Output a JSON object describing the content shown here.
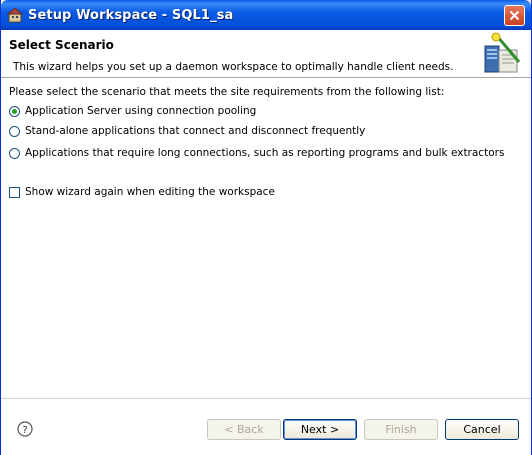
{
  "window": {
    "title": "Setup Workspace - SQL1_sa"
  },
  "header": {
    "title": "Select Scenario",
    "description": "This wizard helps you set up a daemon workspace to optimally handle client needs."
  },
  "content": {
    "prompt": "Please select the scenario that meets the site requirements from the following list:",
    "options": [
      {
        "label": "Application Server using connection pooling",
        "selected": true
      },
      {
        "label": "Stand-alone applications that connect and disconnect frequently",
        "selected": false
      },
      {
        "label": "Applications that require long connections, such as reporting programs and bulk extractors",
        "selected": false
      }
    ],
    "checkbox": {
      "label": "Show wizard again when editing the workspace",
      "checked": false
    }
  },
  "footer": {
    "back_label": "< Back",
    "next_label": "Next >",
    "finish_label": "Finish",
    "cancel_label": "Cancel"
  },
  "colors": {
    "titlebar": "#0a5ae6",
    "radio_dot": "#21a121",
    "window_bg": "#ece9d8"
  }
}
